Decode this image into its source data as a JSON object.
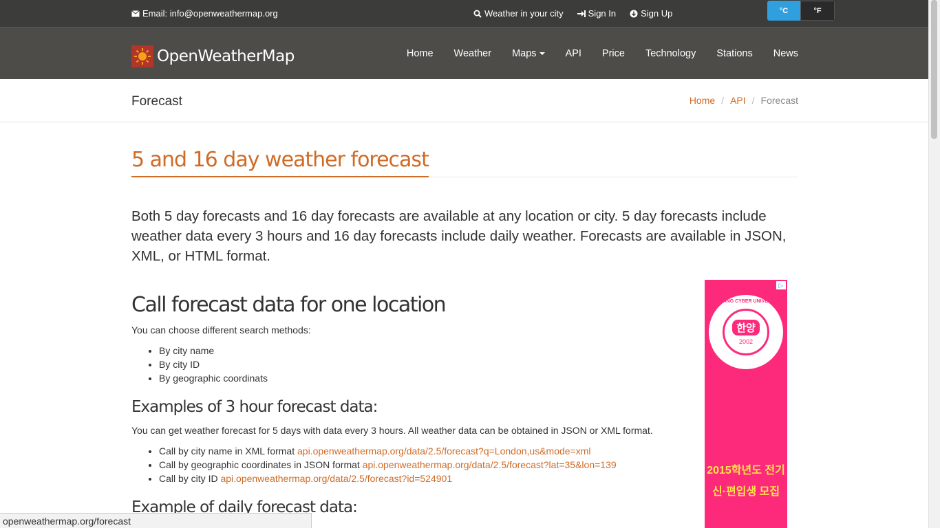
{
  "topbar": {
    "email": "Email: info@openweathermap.org",
    "weather_in_city": "Weather in your city",
    "sign_in": "Sign In",
    "sign_up": "Sign Up",
    "unit_c": "°C",
    "unit_f": "°F"
  },
  "navbar": {
    "brand": "OpenWeatherMap",
    "items": [
      "Home",
      "Weather",
      "Maps",
      "API",
      "Price",
      "Technology",
      "Stations",
      "News"
    ]
  },
  "subheader": {
    "title": "Forecast",
    "breadcrumb": [
      "Home",
      "API",
      "Forecast"
    ],
    "separator": "/"
  },
  "main": {
    "heading": "5 and 16 day weather forecast",
    "lead": "Both 5 day forecasts and 16 day forecasts are available at any location or city. 5 day forecasts include weather data every 3 hours and 16 day forecasts include daily weather. Forecasts are available in JSON, XML, or HTML format.",
    "section1": {
      "heading": "Call forecast data for one location",
      "intro": "You can choose different search methods:",
      "methods": [
        "By city name",
        "By city ID",
        "By geographic coordinats"
      ]
    },
    "section2": {
      "heading": "Examples of 3 hour forecast data:",
      "intro": "You can get weather forecast for 5 days with data every 3 hours. All weather data can be obtained in JSON or XML format.",
      "examples": [
        {
          "label": "Call by city name in XML format ",
          "link": "api.openweathermap.org/data/2.5/forecast?q=London,us&mode=xml"
        },
        {
          "label": "Call by geographic coordinates in JSON format ",
          "link": "api.openweathermap.org/data/2.5/forecast?lat=35&lon=139"
        },
        {
          "label": "Call by city ID ",
          "link": "api.openweathermap.org/data/2.5/forecast?id=524901"
        }
      ]
    },
    "section3": {
      "heading": "Example of daily forecast data:"
    }
  },
  "ad": {
    "badge": "▷",
    "seal_ring": "HANYANG CYBER UNIVERSITY",
    "seal_text": "한양",
    "seal_year": "2002",
    "line1": "2015학년도 전기",
    "line2": "신·편입생 모집"
  },
  "statusbar": {
    "url": "openweathermap.org/forecast"
  },
  "colors": {
    "accent": "#d06b25",
    "topbar": "#3c3c3a",
    "navbar": "#4d4c48",
    "ad_bg": "#fd2a7c",
    "unit_active": "#2f9fde"
  }
}
